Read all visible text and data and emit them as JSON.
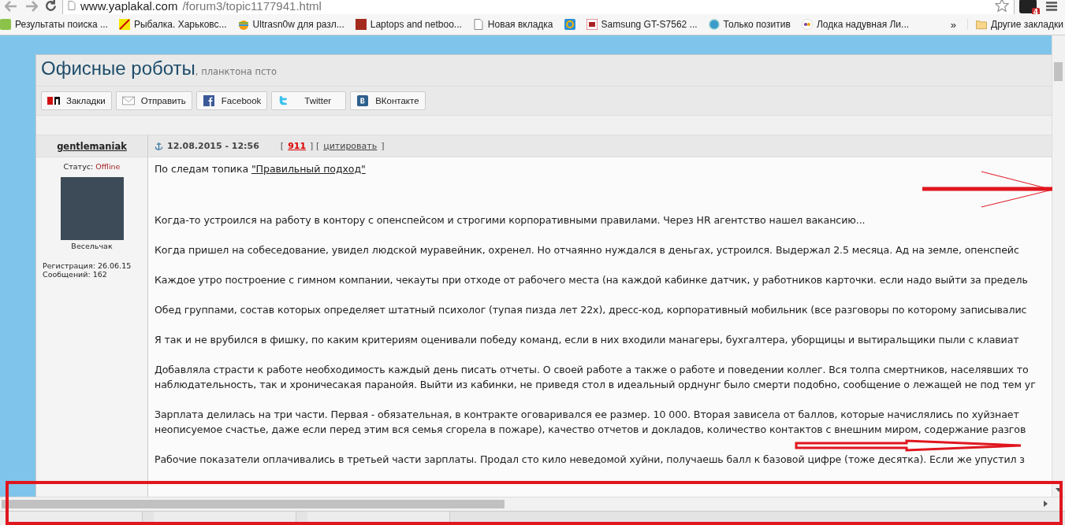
{
  "browser": {
    "address": {
      "host": "www.yaplakal.com",
      "path": "/forum3/topic1177941.html"
    },
    "extension_badge": "4",
    "bookmarks": [
      {
        "kind": "green",
        "label": "Результаты поиска ..."
      },
      {
        "kind": "yellow",
        "label": "Рыбалка. Харьковс..."
      },
      {
        "kind": "apple",
        "label": "Ultrasn0w для разл..."
      },
      {
        "kind": "darkred",
        "label": "Laptops and netboo..."
      },
      {
        "kind": "page",
        "label": "Новая вкладка"
      },
      {
        "kind": "mail"
      },
      {
        "kind": "mplus",
        "label": "Samsung GT-S7562 ..."
      },
      {
        "kind": "circle",
        "label": "Только позитив"
      },
      {
        "kind": "olx",
        "label": "Лодка надувная Ли..."
      }
    ],
    "bookmarks_more": "»",
    "other_bookmarks": "Другие закладки"
  },
  "topic": {
    "title": "Офисные роботы",
    "subtitle": ", планктона псто"
  },
  "share_buttons": [
    {
      "kind": "yap",
      "label": "Закладки"
    },
    {
      "kind": "mail",
      "label": "Отправить"
    },
    {
      "kind": "facebook",
      "label": "Facebook"
    },
    {
      "kind": "twitter",
      "label": "Twitter"
    },
    {
      "kind": "vk",
      "label": "ВКонтакте"
    }
  ],
  "post": {
    "author": "gentlemaniak",
    "date": "12.08.2015 - 12:56",
    "brackets": [
      "[",
      "] [",
      "]"
    ],
    "rating": "911",
    "quote_link": "цитировать",
    "status_label": "Статус:",
    "status": "Offline",
    "rank": "Весельчак",
    "registration": "Регистрация: 26.06.15",
    "messages": "Сообщений: 162",
    "intro": "По следам топика ",
    "intro_link": "\"Правильный подход\"",
    "paragraphs": [
      [
        "Когда-то устроился на работу в контору с опенспейсом и строгими корпоративными правилами. Через HR агентство нашел вакансию..."
      ],
      [
        "Когда пришел на собеседование, увидел людской муравейник, охренел. Но отчаянно нуждался в деньгах, устроился. Выдержал 2.5 месяца. Ад на земле, опенспейс"
      ],
      [
        "Каждое утро построение с гимном компании, чекауты при отходе от рабочего места (на каждой кабинке датчик, у работников карточки. если надо выйти за предель"
      ],
      [
        "Обед группами, состав которых определяет штатный психолог (тупая пизда лет 22х), дресс-код, корпоративный мобильник (все разговоры по которому записывалис"
      ],
      [
        "Я так и не врубился в фишку, по каким критериям оценивали победу команд, если в них входили манагеры, бухгалтера, уборщицы и вытиральщики пыли с клавиат"
      ],
      [
        "Добавляла страсти к работе необходимость каждый день писать отчеты. О своей работе а также о работе и поведении коллег. Вся толпа смертников, населявших то",
        "наблюдательность, так и хроничесакая паранойя. Выйти из кабинки, не приведя стол в идеальный орднунг было смерти подобно, сообщение о лежащей не под тем уг"
      ],
      [
        "Зарплата делилась на три части. Первая - обязательная, в контракте оговаривался ее размер. 10 000. Вторая зависела от баллов, которые начислялись по хуйзнает",
        "неописуемое счастье, даже если перед этим вся семья сгорела в пожаре), качество отчетов и докладов, количество контактов с внешним миром, содержание разгов"
      ],
      [
        "Рабочие показатели оплачивались в третьей части зарплаты. Продал сто кило неведомой хуйни, получаешь балл к базовой цифре (тоже десятка). Если же упустил з"
      ]
    ]
  }
}
